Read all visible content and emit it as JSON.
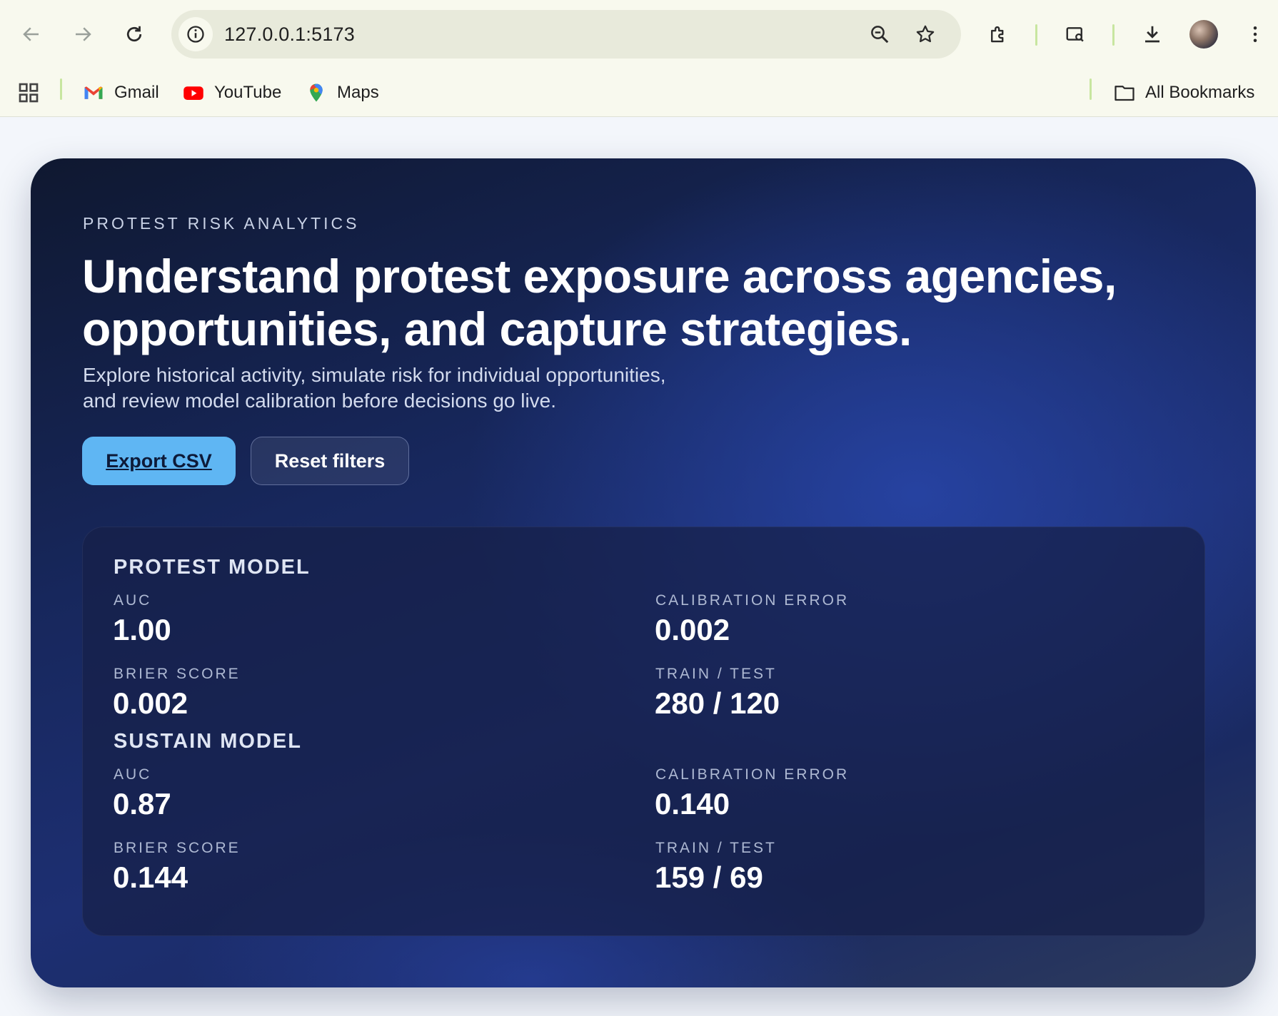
{
  "browser": {
    "url": "127.0.0.1:5173",
    "icons": [
      "back-icon",
      "forward-icon",
      "reload-icon",
      "site-info-icon",
      "zoom-icon",
      "star-icon",
      "extensions-icon",
      "cast-icon",
      "download-icon",
      "profile-avatar",
      "menu-icon"
    ],
    "bookmarks": [
      {
        "label": "Gmail",
        "icon": "gmail-icon"
      },
      {
        "label": "YouTube",
        "icon": "youtube-icon"
      },
      {
        "label": "Maps",
        "icon": "maps-icon"
      }
    ],
    "all_bookmarks": "All Bookmarks"
  },
  "hero": {
    "eyebrow": "PROTEST RISK ANALYTICS",
    "headline_line1": "Understand protest exposure across agencies,",
    "headline_line2": "opportunities, and capture strategies.",
    "subtitle_line1": "Explore historical activity, simulate risk for individual opportunities,",
    "subtitle_line2": "and review model calibration before decisions go live.",
    "export_label": "Export CSV",
    "reset_label": "Reset filters"
  },
  "models": {
    "protest": {
      "title": "PROTEST MODEL",
      "auc_label": "AUC",
      "auc": "1.00",
      "calibration_label": "CALIBRATION ERROR",
      "calibration": "0.002",
      "brier_label": "BRIER SCORE",
      "brier": "0.002",
      "split_label": "TRAIN / TEST",
      "split": "280 / 120"
    },
    "sustain": {
      "title": "SUSTAIN MODEL",
      "auc_label": "AUC",
      "auc": "0.87",
      "calibration_label": "CALIBRATION ERROR",
      "calibration": "0.140",
      "brier_label": "BRIER SCORE",
      "brier": "0.144",
      "split_label": "TRAIN / TEST",
      "split": "159 / 69"
    }
  },
  "colors": {
    "accent": "#5fb6f3",
    "hero_dark": "#0f1830",
    "hero_blue": "#1d2f72"
  }
}
